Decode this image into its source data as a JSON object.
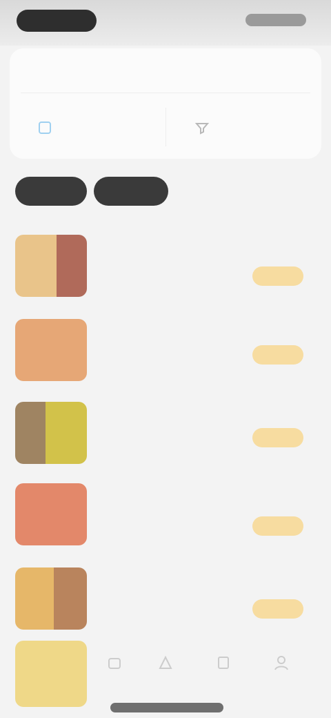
{
  "search": {
    "placeholder": ""
  },
  "actions": [
    {
      "label": "",
      "icon": "scan-icon"
    },
    {
      "label": "",
      "icon": "filter-icon"
    }
  ],
  "chips": [
    {
      "label": ""
    },
    {
      "label": ""
    },
    {
      "label": ""
    }
  ],
  "items": [
    {
      "title": "",
      "meta": "",
      "price": ""
    },
    {
      "title": "",
      "meta": "",
      "price": ""
    },
    {
      "title": "",
      "meta": "",
      "price": ""
    },
    {
      "title": "",
      "meta": "",
      "price": ""
    },
    {
      "title": "",
      "meta": "",
      "price": ""
    }
  ],
  "colors": {
    "accent_button_bg": "#f7dca0",
    "chip_dark": "#3a3a3a"
  }
}
